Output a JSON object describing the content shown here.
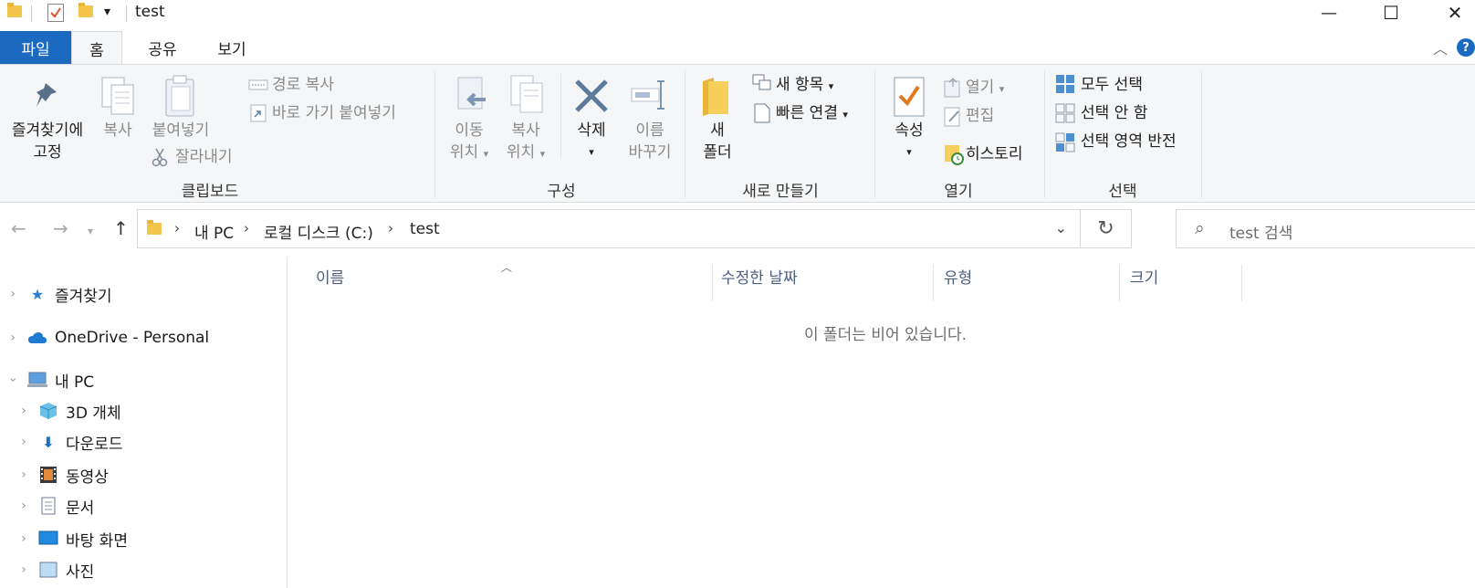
{
  "window": {
    "title": "test",
    "quick_access_dropdown": "▾",
    "controls": {
      "minimize": "—",
      "maximize": "☐",
      "close": "✕"
    }
  },
  "ribbon_tabs": [
    "파일",
    "홈",
    "공유",
    "보기"
  ],
  "help_label": "?",
  "ribbon": {
    "clipboard": {
      "label": "클립보드",
      "pin_line1": "즐겨찾기에",
      "pin_line2": "고정",
      "copy": "복사",
      "paste": "붙여넣기",
      "copy_path": "경로 복사",
      "paste_shortcut": "바로 가기 붙여넣기",
      "cut": "잘라내기"
    },
    "organize": {
      "label": "구성",
      "move_line1": "이동",
      "move_line2": "위치",
      "copyto_line1": "복사",
      "copyto_line2": "위치",
      "delete": "삭제",
      "rename_line1": "이름",
      "rename_line2": "바꾸기"
    },
    "new": {
      "label": "새로 만들기",
      "folder_line1": "새",
      "folder_line2": "폴더",
      "new_item": "새 항목",
      "easy_access": "빠른 연결"
    },
    "open": {
      "label": "열기",
      "properties": "속성",
      "open": "열기",
      "edit": "편집",
      "history": "히스토리"
    },
    "select": {
      "label": "선택",
      "select_all": "모두 선택",
      "select_none": "선택 안 함",
      "invert": "선택 영역 반전"
    }
  },
  "address": {
    "crumbs": [
      "내 PC",
      "로컬 디스크 (C:)",
      "test"
    ],
    "search_placeholder": "test 검색"
  },
  "nav_pane": {
    "items": [
      {
        "label": "즐겨찾기",
        "icon": "star-icon"
      },
      {
        "label": "OneDrive - Personal",
        "icon": "cloud-icon"
      },
      {
        "label": "내 PC",
        "icon": "computer-icon"
      },
      {
        "label": "3D 개체",
        "icon": "cube-icon"
      },
      {
        "label": "다운로드",
        "icon": "download-icon"
      },
      {
        "label": "동영상",
        "icon": "video-icon"
      },
      {
        "label": "문서",
        "icon": "document-icon"
      },
      {
        "label": "바탕 화면",
        "icon": "desktop-icon"
      },
      {
        "label": "사진",
        "icon": "picture-icon"
      }
    ]
  },
  "columns": [
    "이름",
    "수정한 날짜",
    "유형",
    "크기"
  ],
  "empty_message": "이 폴더는 비어 있습니다."
}
